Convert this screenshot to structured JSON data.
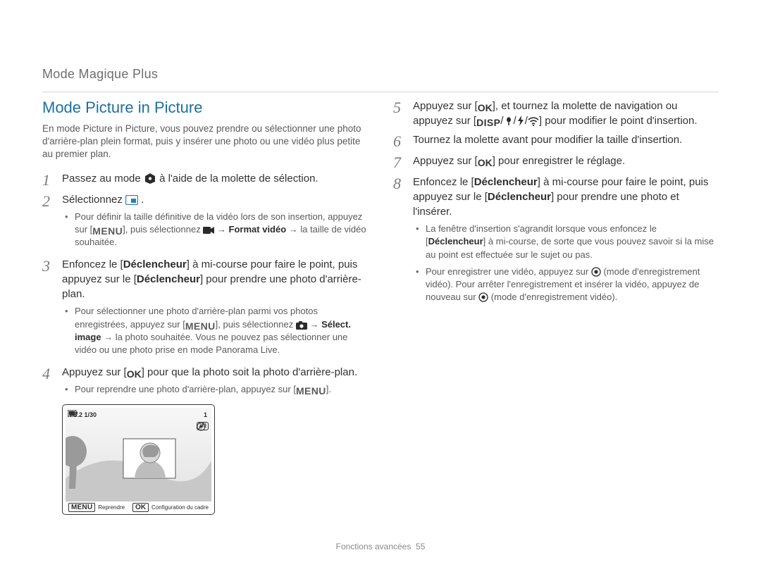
{
  "header": {
    "title": "Mode Magique Plus"
  },
  "h1": "Mode Picture in Picture",
  "intro": "En mode Picture in Picture, vous pouvez prendre ou sélectionner une photo d'arrière-plan plein format, puis y insérer une photo ou une vidéo plus petite au premier plan.",
  "steps_left": [
    {
      "n": "1",
      "text": [
        "Passez au mode ",
        {
          "icon": "mode-dial"
        },
        " à l'aide de la molette de sélection."
      ]
    },
    {
      "n": "2",
      "text": [
        "Sélectionnez ",
        {
          "icon": "pip-mode"
        },
        " ."
      ],
      "sub": [
        {
          "frags": [
            "Pour définir la taille définitive de la vidéo lors de son insertion, appuyez sur [",
            {
              "icon": "menu-label"
            },
            "], puis sélectionnez ",
            {
              "icon": "movie"
            },
            " → ",
            {
              "bold": "Format vidéo"
            },
            " → la taille de vidéo souhaitée."
          ]
        }
      ]
    },
    {
      "n": "3",
      "text": [
        "Enfoncez le [",
        {
          "bold": "Déclencheur"
        },
        "] à mi-course pour faire le point, puis appuyez sur le [",
        {
          "bold": "Déclencheur"
        },
        "] pour prendre une photo d'arrière-plan."
      ],
      "sub": [
        {
          "frags": [
            "Pour sélectionner une photo d'arrière-plan parmi vos photos enregistrées, appuyez sur [",
            {
              "icon": "menu-label"
            },
            "], puis sélectionnez ",
            {
              "icon": "camera"
            },
            " → ",
            {
              "bold": "Sélect. image"
            },
            " → la photo souhaitée. Vous ne pouvez pas sélectionner une vidéo ou une photo prise en mode Panorama Live."
          ]
        }
      ]
    },
    {
      "n": "4",
      "text": [
        "Appuyez sur [",
        {
          "icon": "ok-label"
        },
        "] pour que la photo soit la photo d'arrière-plan."
      ],
      "sub": [
        {
          "frags": [
            "Pour reprendre une photo d'arrière-plan, appuyez sur [",
            {
              "icon": "menu-label"
            },
            "]."
          ]
        }
      ]
    }
  ],
  "steps_right": [
    {
      "n": "5",
      "text": [
        "Appuyez sur [",
        {
          "icon": "ok-label"
        },
        "], et tournez la molette de navigation ou appuyez sur [",
        {
          "icon": "disp-label"
        },
        "/",
        {
          "icon": "macro"
        },
        "/",
        {
          "icon": "flash"
        },
        "/",
        {
          "icon": "wifi"
        },
        "] pour modifier le point d'insertion."
      ]
    },
    {
      "n": "6",
      "text": [
        "Tournez la molette avant pour modifier la taille d'insertion."
      ]
    },
    {
      "n": "7",
      "text": [
        "Appuyez sur [",
        {
          "icon": "ok-label"
        },
        "] pour enregistrer le réglage."
      ]
    },
    {
      "n": "8",
      "text": [
        "Enfoncez le [",
        {
          "bold": "Déclencheur"
        },
        "] à mi-course pour faire le point, puis appuyez sur le [",
        {
          "bold": "Déclencheur"
        },
        "] pour prendre une photo et l'insérer."
      ],
      "sub": [
        {
          "frags": [
            "La fenêtre d'insertion s'agrandit lorsque vous enfoncez le [",
            {
              "bold": "Déclencheur"
            },
            "] à mi-course, de sorte que vous pouvez savoir si la mise au point est effectuée sur le sujet ou pas."
          ]
        },
        {
          "frags": [
            "Pour enregistrer une vidéo, appuyez sur ",
            {
              "icon": "rec"
            },
            " (mode d'enregistrement vidéo). Pour arrêter l'enregistrement et insérer la vidéo, appuyez de nouveau sur ",
            {
              "icon": "rec"
            },
            " (mode d'enregistrement vidéo)."
          ]
        }
      ]
    }
  ],
  "illustration": {
    "top_left": "F3.2 1/30",
    "top_right": "1",
    "badge1": "3M",
    "bottom_left_label": "MENU",
    "bottom_left_text": "Reprendre",
    "bottom_right_label": "OK",
    "bottom_right_text": "Configuration du cadre"
  },
  "footer": {
    "section": "Fonctions avancées",
    "page": "55"
  },
  "icons": {
    "menu_text": "MENU",
    "ok_text": "OK",
    "disp_text": "DISP"
  }
}
